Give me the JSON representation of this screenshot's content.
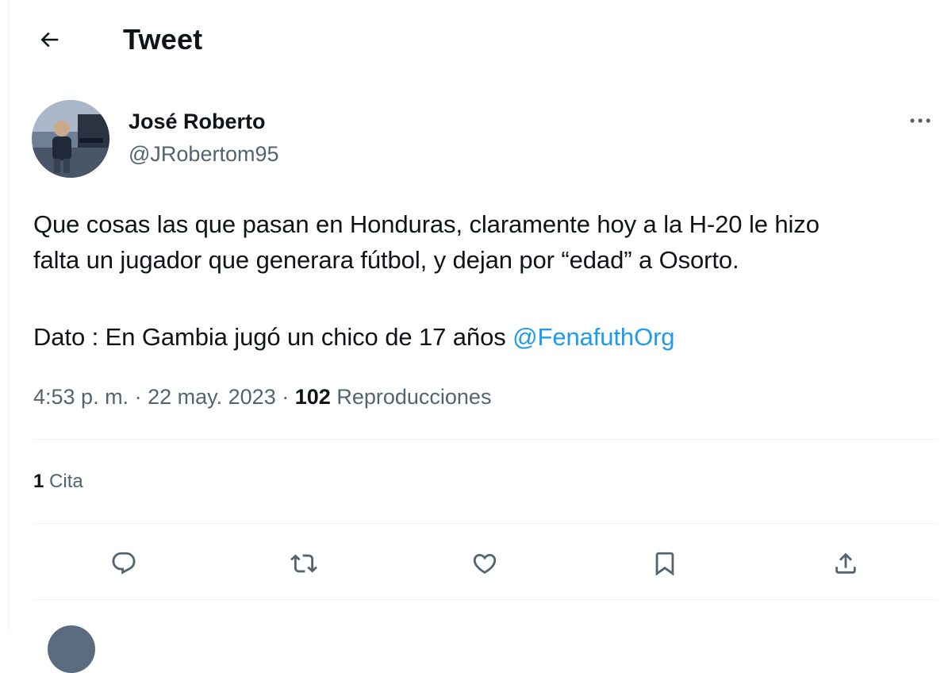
{
  "header": {
    "back_icon": "arrow-left-icon",
    "title": "Tweet"
  },
  "author": {
    "name": "José Roberto",
    "handle": "@JRobertom95",
    "avatar": "profile photo"
  },
  "more_icon": "more-dots-icon",
  "tweet": {
    "line1": "Que cosas las que pasan en Honduras, claramente hoy a la H-20 le hizo",
    "line2": "falta un jugador que generara fútbol, y dejan por “edad” a Osorto.",
    "line3_prefix": "Dato : En Gambia jugó un chico de 17 años ",
    "mention": "@FenafuthOrg"
  },
  "meta": {
    "time": "4:53 p. m.",
    "separator": "·",
    "date": "22 may. 2023",
    "views_count": "102",
    "views_label": "Reproducciones"
  },
  "quotes": {
    "count": "1",
    "label": "Cita"
  },
  "actions": [
    {
      "name": "reply",
      "icon": "reply-bubble-icon"
    },
    {
      "name": "retweet",
      "icon": "retweet-icon"
    },
    {
      "name": "like",
      "icon": "heart-icon"
    },
    {
      "name": "bookmark",
      "icon": "bookmark-icon"
    },
    {
      "name": "share",
      "icon": "share-upload-icon"
    }
  ],
  "colors": {
    "text": "#0f1419",
    "secondary": "#536471",
    "link": "#1d9bf0",
    "divider": "#eff3f4"
  }
}
